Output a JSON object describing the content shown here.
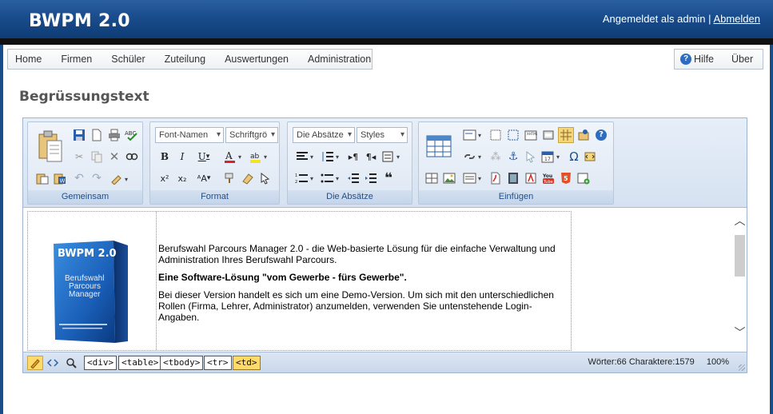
{
  "app": {
    "title": "BWPM 2.0"
  },
  "login": {
    "text": "Angemeldet als admin",
    "separator": "|",
    "logout": "Abmelden"
  },
  "nav": {
    "items": [
      "Home",
      "Firmen",
      "Schüler",
      "Zuteilung",
      "Auswertungen",
      "Administration"
    ],
    "help": "Hilfe",
    "about": "Über"
  },
  "page": {
    "title": "Begrüssungstext"
  },
  "ribbon": {
    "groups": [
      "Gemeinsam",
      "Format",
      "Die Absätze",
      "Einfügen"
    ],
    "font_name": "Font-Namen",
    "font_size": "Schriftgrö",
    "paragraph": "Die Absätze",
    "styles": "Styles"
  },
  "product_box": {
    "title": "BWPM 2.0",
    "subtitle_1": "Berufswahl",
    "subtitle_2": "Parcours",
    "subtitle_3": "Manager"
  },
  "document": {
    "p1": "Berufswahl Parcours Manager 2.0 - die Web-basierte Lösung für die einfache Verwaltung und Administration Ihres Berufswahl Parcours.",
    "p2": "Eine Software-Lösung \"vom Gewerbe - fürs Gewerbe\".",
    "p3": "Bei dieser Version handelt es sich um eine Demo-Version. Um sich mit den unterschiedlichen Rollen (Firma, Lehrer, Administrator) anzumelden, verwenden Sie untenstehende Login-Angaben."
  },
  "statusbar": {
    "tags": [
      "<div>",
      "<table>",
      "<tbody>",
      "<tr>",
      "<td>"
    ],
    "active_tag": "<td>",
    "stats": "Wörter:66 Charaktere:1579",
    "zoom": "100%"
  },
  "colors": {
    "header": "#1b4e8e",
    "accent": "#2d6cc0",
    "active_tag": "#ffd96a"
  }
}
